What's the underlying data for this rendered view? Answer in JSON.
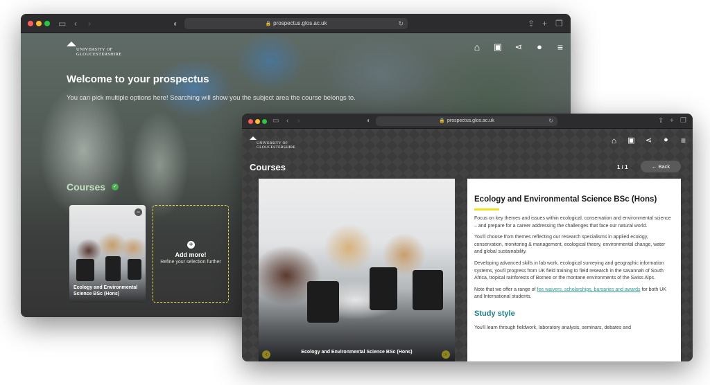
{
  "browser": {
    "url": "prospectus.glos.ac.uk"
  },
  "brand": {
    "line1": "UNIVERSITY OF",
    "line2": "GLOUCESTERSHIRE"
  },
  "nav_icons": [
    "home-icon",
    "save-icon",
    "share-icon",
    "chat-icon",
    "menu-icon"
  ],
  "welcome": {
    "title": "Welcome to your prospectus",
    "subtitle": "You can pick multiple options here! Searching will show you the subject area the course belongs to.",
    "courses_label": "Courses",
    "selected_course": "Ecology and Environmental Science BSc (Hons)",
    "add_more_title": "Add more!",
    "add_more_sub": "Refine your selection further"
  },
  "courses_page": {
    "title": "Courses",
    "pager": "1 / 1",
    "back_label": "Back",
    "photo_caption": "Ecology and Environmental Science BSc (Hons)",
    "course_title": "Ecology and Environmental Science BSc (Hons)",
    "para1": "Focus on key themes and issues within ecological, conservation and environmental science – and prepare for a career addressing the challenges that face our natural world.",
    "para2": "You'll choose from themes reflecting our research specialisms in applied ecology, conservation, monitoring & management, ecological theory, environmental change, water and global sustainability.",
    "para3": "Developing advanced skills in lab work, ecological surveying and geographic information systems, you'll progress from UK field training to field research in the savannah of South Africa, tropical rainforests of Borneo or the montane environments of the Swiss Alps.",
    "para4_pre": "Note that we offer a range of ",
    "para4_link": "fee waivers, scholarships, bursaries and awards",
    "para4_post": " for both UK and International students.",
    "study_style_heading": "Study style",
    "para5": "You'll learn through fieldwork, laboratory analysis, seminars, debates and"
  },
  "colors": {
    "accent_yellow": "#f1e21f",
    "teal": "#1e7f8a",
    "green_check": "#4caf50"
  }
}
